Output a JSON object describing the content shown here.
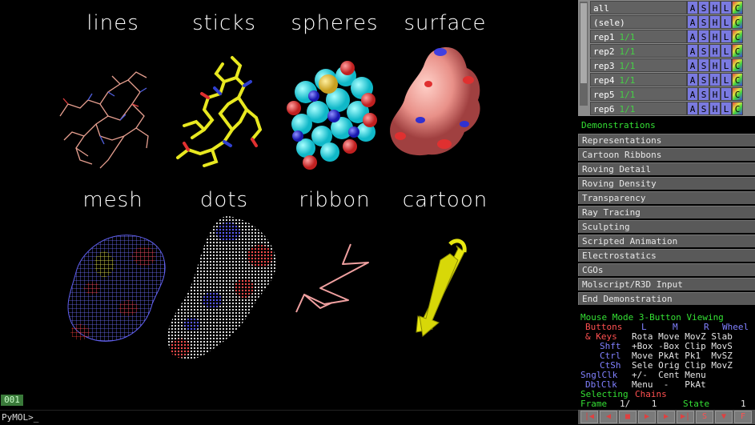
{
  "viewer": {
    "labels": [
      "lines",
      "sticks",
      "spheres",
      "surface",
      "mesh",
      "dots",
      "ribbon",
      "cartoon"
    ],
    "frame_badge": "001",
    "command_prompt": "PyMOL>_"
  },
  "objects": [
    {
      "name": "all",
      "state": ""
    },
    {
      "name": "(sele)",
      "state": ""
    },
    {
      "name": "rep1",
      "state": "1/1"
    },
    {
      "name": "rep2",
      "state": "1/1"
    },
    {
      "name": "rep3",
      "state": "1/1"
    },
    {
      "name": "rep4",
      "state": "1/1"
    },
    {
      "name": "rep5",
      "state": "1/1"
    },
    {
      "name": "rep6",
      "state": "1/1"
    }
  ],
  "object_buttons": [
    "A",
    "S",
    "H",
    "L",
    "C"
  ],
  "demos": {
    "title": "Demonstrations",
    "items": [
      "Representations",
      "Cartoon Ribbons",
      "Roving Detail",
      "Roving Density",
      "Transparency",
      "Ray Tracing",
      "Sculpting",
      "Scripted Animation",
      "Electrostatics",
      "CGOs",
      "Molscript/R3D Input",
      "End Demonstration"
    ]
  },
  "mouse": {
    "mode_line": "Mouse Mode 3-Button Viewing",
    "buttons_label": "Buttons",
    "btn_L": "L",
    "btn_M": "M",
    "btn_R": "R",
    "btn_Wheel": "Wheel",
    "rows": [
      {
        "key": "& Keys",
        "vals": "Rota Move MovZ Slab"
      },
      {
        "key": "Shft",
        "vals": "+Box -Box Clip MovS"
      },
      {
        "key": "Ctrl",
        "vals": "Move PkAt Pk1  MvSZ"
      },
      {
        "key": "CtSh",
        "vals": "Sele Orig Clip MovZ"
      },
      {
        "key": "SnglClk",
        "vals": "+/-  Cent Menu"
      },
      {
        "key": "DblClk",
        "vals": "Menu  -   PkAt"
      }
    ],
    "selecting": "Selecting",
    "selecting_value": "Chains",
    "frame_label": "Frame",
    "frame_value": "1/    1",
    "state_label": "State",
    "state_value": "1"
  },
  "playback": [
    "|◀",
    "◀",
    "■",
    "▶",
    "▶",
    "▶|",
    "S",
    "▼",
    "F"
  ],
  "colors": {
    "accent_green": "#34e034",
    "red": "#ff5050",
    "blue_key": "#8080ff"
  }
}
